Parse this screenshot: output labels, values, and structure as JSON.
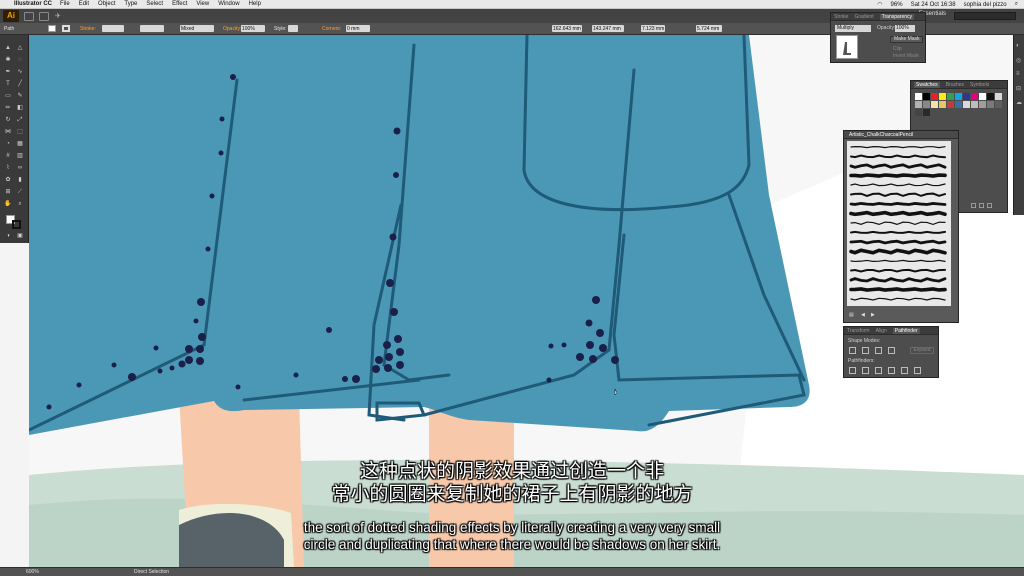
{
  "menubar": {
    "app_name": "Illustrator CC",
    "items": [
      "File",
      "Edit",
      "Object",
      "Type",
      "Select",
      "Effect",
      "View",
      "Window",
      "Help"
    ],
    "battery": "96%",
    "datetime": "Sat 24 Oct 16:38",
    "user": "sophia del pizzo"
  },
  "appbar": {
    "logo": "Ai",
    "workspace": "Essentials"
  },
  "control_bar": {
    "selection_label": "Path",
    "stroke_label": "Stroke:",
    "stroke_profile": "Basic",
    "brush_value": "Mixed",
    "opacity_label": "Opacity:",
    "opacity_value": "100%",
    "style_label": "Style:",
    "corners_label": "Corners:",
    "corners_value": "0 mm",
    "x_value": "162.643 mm",
    "y_value": "143.247 mm",
    "w_value": "7.123 mm",
    "h_value": "5.724 mm"
  },
  "transparency_panel": {
    "tabs": [
      "Stroke",
      "Gradient",
      "Transparency"
    ],
    "active_tab": "Transparency",
    "blend_mode": "Multiply",
    "opacity_label": "Opacity:",
    "opacity_value": "100%",
    "make_mask": "Make Mask",
    "clip": "Clip",
    "invert_mask": "Invert Mask"
  },
  "swatches_panel": {
    "tabs": [
      "Swatches",
      "Brushes",
      "Symbols"
    ],
    "active_tab": "Swatches",
    "colors": [
      "#ffffff",
      "#000000",
      "#e8202a",
      "#f7ec13",
      "#2ea44f",
      "#18a4e2",
      "#2c3891",
      "#e6007e",
      "#ffffff",
      "#111111",
      "#d8d8d8",
      "#b0b0b0",
      "#888888",
      "#f1e6a0",
      "#e9c46a",
      "#c43b3b",
      "#3a6ea5",
      "#d9d9d9",
      "#bdbdbd",
      "#9e9e9e",
      "#7a7a7a",
      "#5e5e5e",
      "#444444",
      "#2a2a2a"
    ]
  },
  "brush_library_panel": {
    "title": "Artistic_ChalkCharcoalPencil",
    "stroke_count": 17
  },
  "pathfinder_panel": {
    "tabs": [
      "Transform",
      "Align",
      "Pathfinder"
    ],
    "active_tab": "Pathfinder",
    "shape_modes_label": "Shape Modes:",
    "expand_label": "Expand",
    "pathfinders_label": "Pathfinders:"
  },
  "statusbar": {
    "zoom": "600%",
    "tool": "Direct Selection"
  },
  "subtitles": {
    "zh_line1": "这种点状的阴影效果通过创造一个非",
    "zh_line2": "常小的圆圈来复制她的裙子上有阴影的地方",
    "en_line1": "the sort of dotted shading effects by literally creating a very very small",
    "en_line2": "circle and duplicating that where there would be shadows on her skirt."
  },
  "colors": {
    "skirt": "#4b98b6",
    "skirt_lines": "#1f5a78",
    "dots": "#1b1f4a",
    "skin": "#f7c8a9",
    "background_green": "#c9ddd2",
    "berry": "#c2244a",
    "interface_dark": "#535353"
  }
}
